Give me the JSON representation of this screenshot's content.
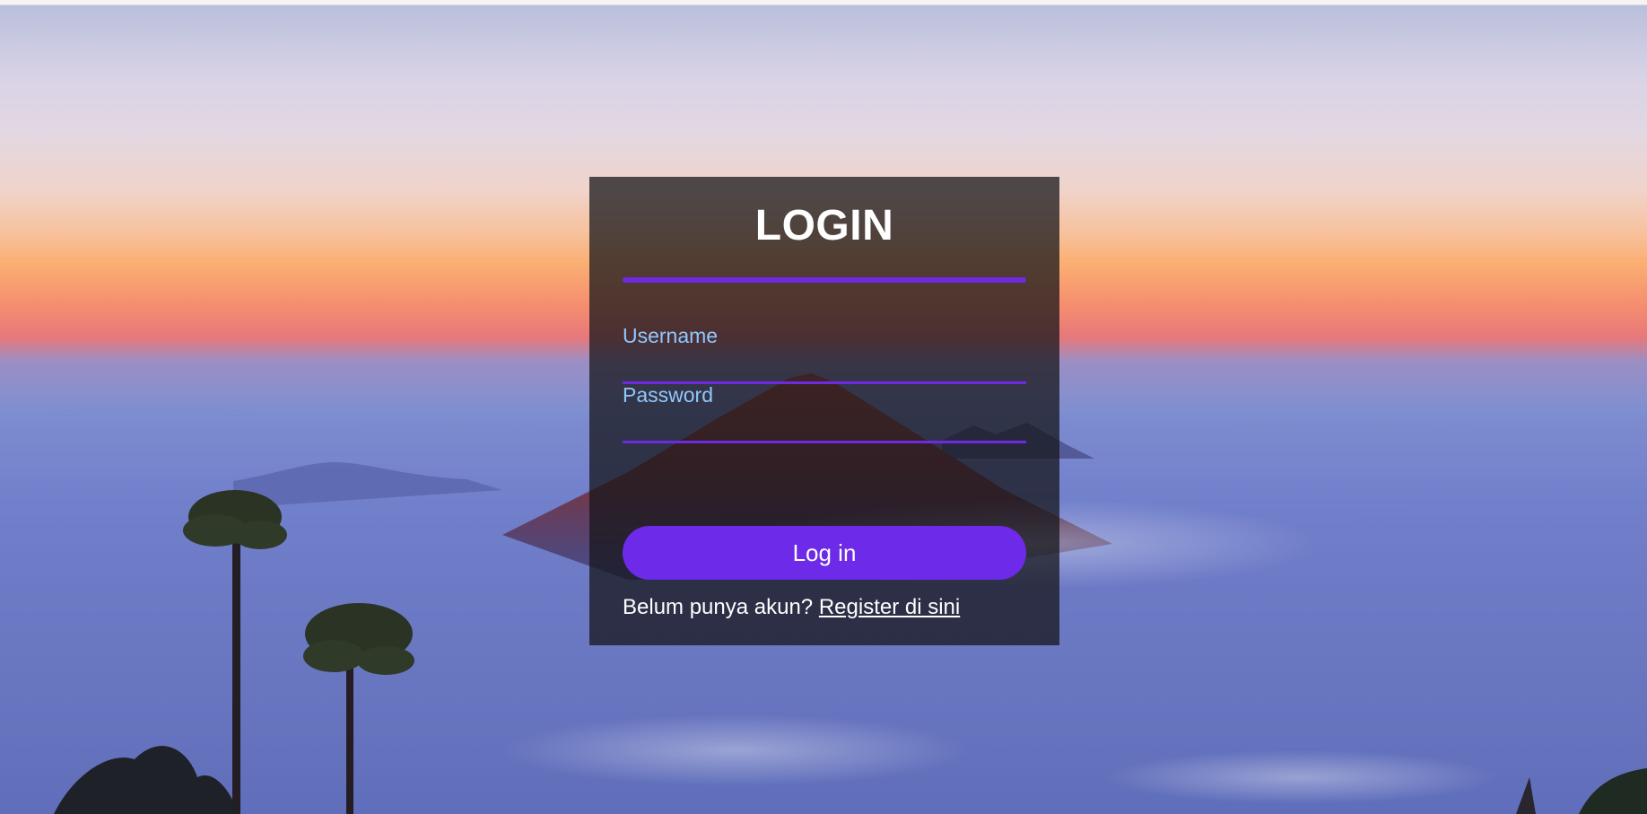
{
  "login": {
    "title": "LOGIN",
    "username_label": "Username",
    "password_label": "Password",
    "login_button": "Log in",
    "register_prompt": "Belum punya akun?",
    "register_link": "Register di sini"
  },
  "colors": {
    "accent": "#6d2ae2",
    "label": "#8fc8ff",
    "card_background": "rgba(22,22,26,0.74)"
  }
}
